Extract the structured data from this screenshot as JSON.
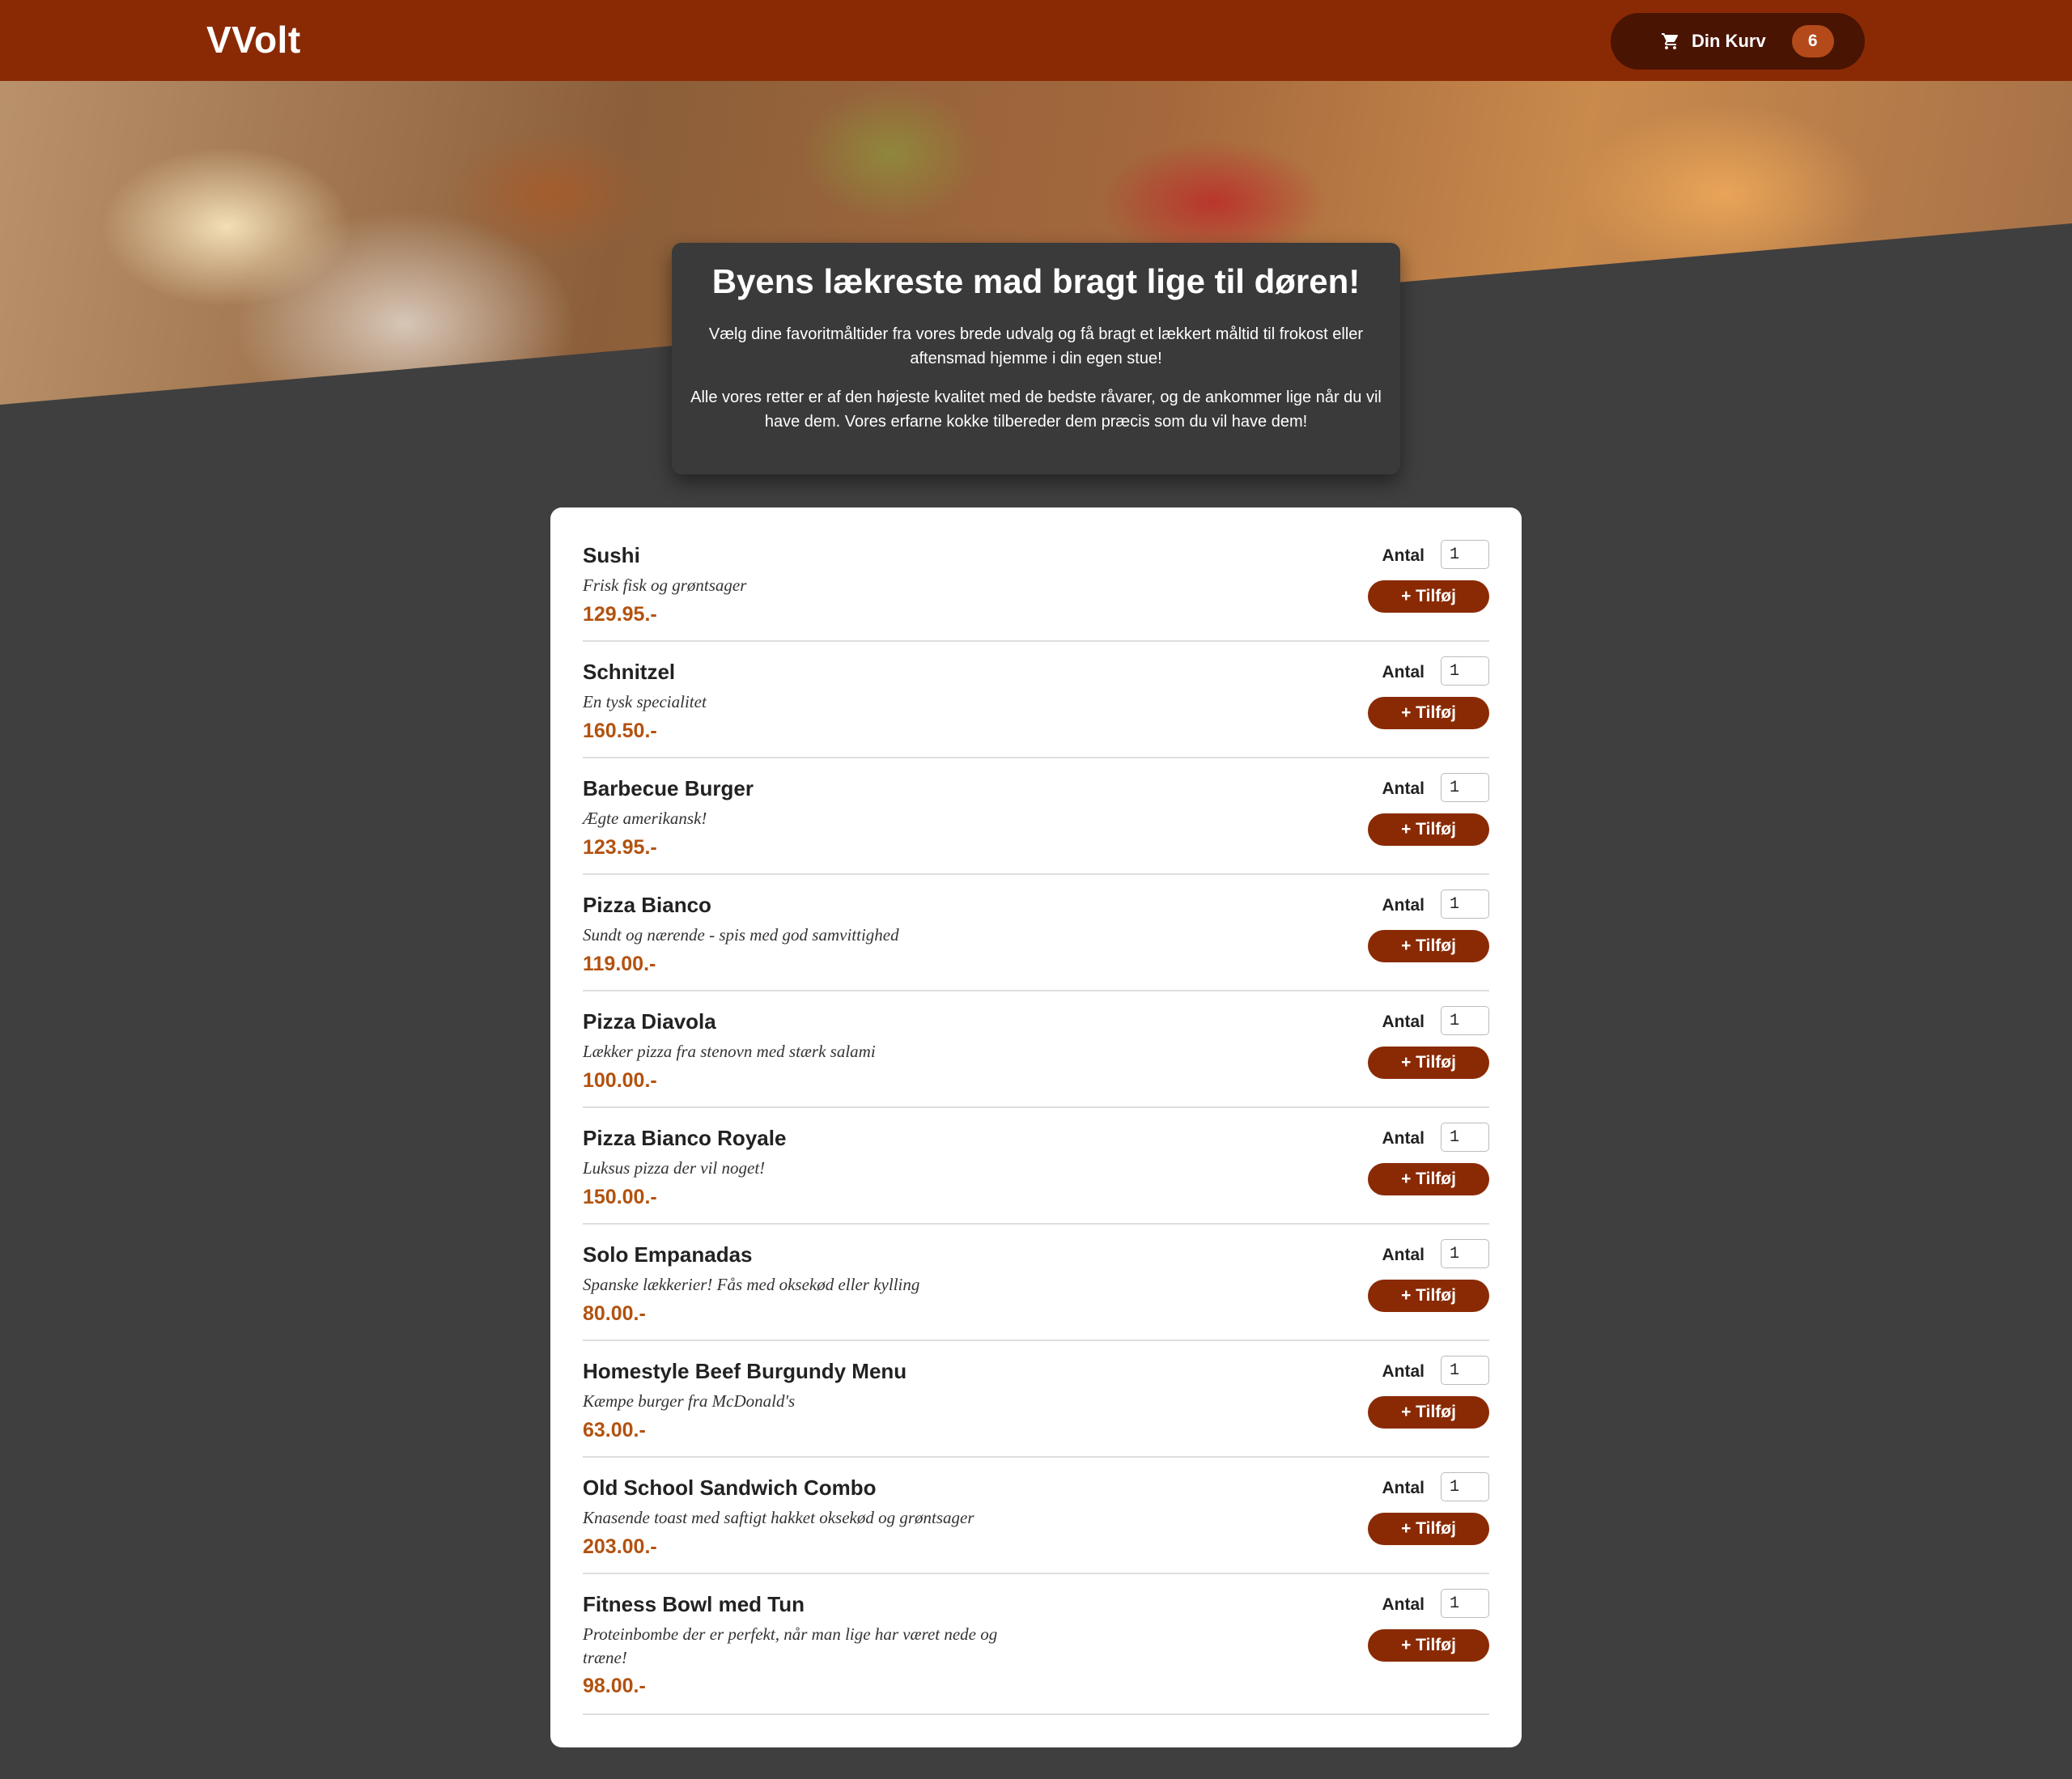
{
  "header": {
    "logo": "VVolt",
    "cart_label": "Din Kurv",
    "cart_count": "6"
  },
  "hero": {
    "title": "Byens lækreste mad bragt lige til døren!",
    "paragraph1": "Vælg dine favoritmåltider fra vores brede udvalg og få bragt et lækkert måltid til frokost eller aftensmad hjemme i din egen stue!",
    "paragraph2": "Alle vores retter er af den højeste kvalitet med de bedste råvarer, og de ankommer lige når du vil have dem. Vores erfarne kokke tilbereder dem præcis som du vil have dem!"
  },
  "menu": {
    "qty_label": "Antal",
    "add_label": "+ Tilføj",
    "items": [
      {
        "name": "Sushi",
        "description": "Frisk fisk og grøntsager",
        "price": "129.95.-",
        "qty": "1"
      },
      {
        "name": "Schnitzel",
        "description": "En tysk specialitet",
        "price": "160.50.-",
        "qty": "1"
      },
      {
        "name": "Barbecue Burger",
        "description": "Ægte amerikansk!",
        "price": "123.95.-",
        "qty": "1"
      },
      {
        "name": "Pizza Bianco",
        "description": "Sundt og nærende - spis med god samvittighed",
        "price": "119.00.-",
        "qty": "1"
      },
      {
        "name": "Pizza Diavola",
        "description": "Lækker pizza fra stenovn med stærk salami",
        "price": "100.00.-",
        "qty": "1"
      },
      {
        "name": "Pizza Bianco Royale",
        "description": "Luksus pizza der vil noget!",
        "price": "150.00.-",
        "qty": "1"
      },
      {
        "name": "Solo Empanadas",
        "description": "Spanske lækkerier! Fås med oksekød eller kylling",
        "price": "80.00.-",
        "qty": "1"
      },
      {
        "name": "Homestyle Beef Burgundy Menu",
        "description": "Kæmpe burger fra McDonald's",
        "price": "63.00.-",
        "qty": "1"
      },
      {
        "name": "Old School Sandwich Combo",
        "description": "Knasende toast med saftigt hakket oksekød og grøntsager",
        "price": "203.00.-",
        "qty": "1"
      },
      {
        "name": "Fitness Bowl med Tun",
        "description": "Proteinbombe der er perfekt, når man lige har været nede og træne!",
        "price": "98.00.-",
        "qty": "1"
      }
    ]
  },
  "colors": {
    "brand": "#8a2a04",
    "price": "#b3520f",
    "background": "#3f3f3f"
  }
}
